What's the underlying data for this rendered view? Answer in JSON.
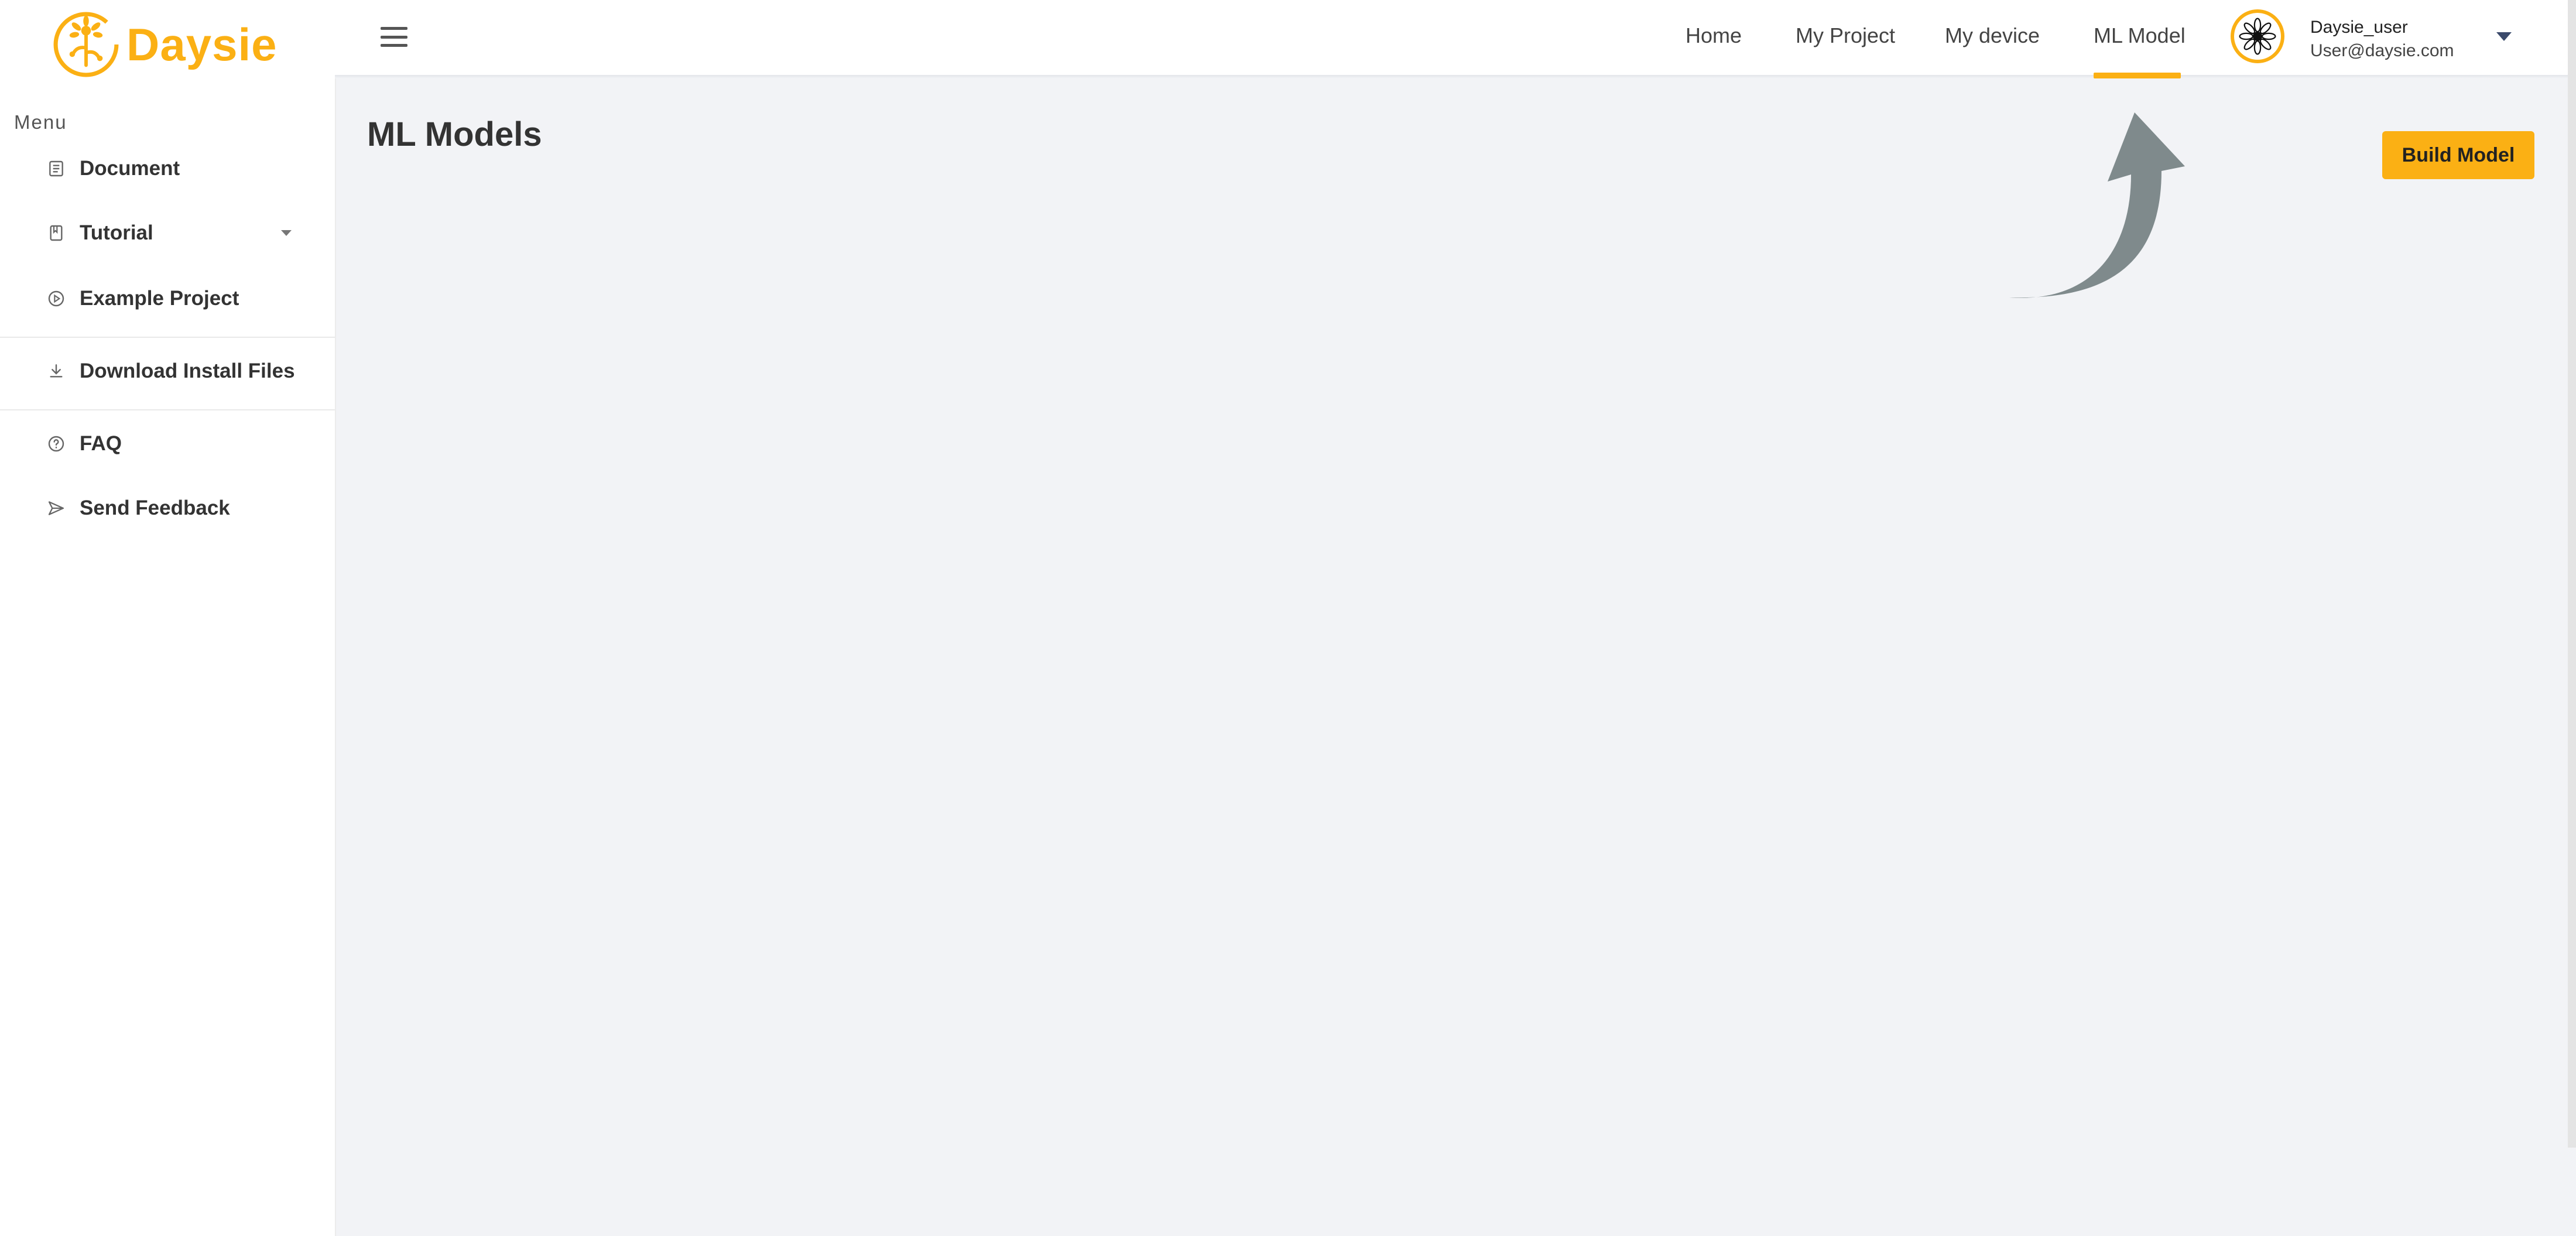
{
  "app": {
    "logo_text": "Daysie"
  },
  "sidebar": {
    "menu_label": "Menu",
    "items": [
      {
        "label": "Document",
        "icon": "document-icon"
      },
      {
        "label": "Tutorial",
        "icon": "book-icon",
        "has_submenu": true
      },
      {
        "label": "Example Project",
        "icon": "play-circle-icon"
      },
      {
        "label": "Download Install Files",
        "icon": "download-icon"
      },
      {
        "label": "FAQ",
        "icon": "help-circle-icon"
      },
      {
        "label": "Send Feedback",
        "icon": "send-icon"
      }
    ]
  },
  "header": {
    "nav": [
      {
        "label": "Home"
      },
      {
        "label": "My Project"
      },
      {
        "label": "My device"
      },
      {
        "label": "ML Model",
        "active": true
      }
    ],
    "user": {
      "name": "Daysie_user",
      "email": "User@daysie.com"
    }
  },
  "main": {
    "title": "ML Models",
    "build_button_label": "Build Model"
  },
  "colors": {
    "accent": "#fbb014",
    "background": "#f2f3f6",
    "arrow": "#7f8a8c"
  }
}
